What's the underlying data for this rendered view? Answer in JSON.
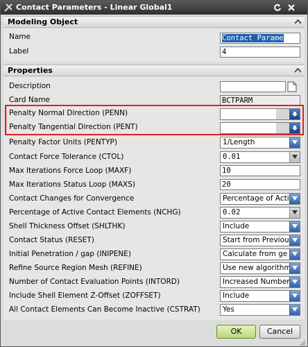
{
  "window": {
    "title": "Contact Parameters - Linear Global1"
  },
  "sections": {
    "modeling_object": "Modeling Object",
    "properties": "Properties"
  },
  "modeling_object": {
    "name_label": "Name",
    "name_value": "Contact Parame",
    "label_label": "Label",
    "label_value": "4"
  },
  "properties": {
    "description_label": "Description",
    "description_value": "",
    "card_name_label": "Card Name",
    "card_name_value": "BCTPARM",
    "penn_label": "Penalty Normal Direction (PENN)",
    "penn_value": "",
    "pent_label": "Penalty Tangential Direction (PENT)",
    "pent_value": "",
    "pentyp_label": "Penalty Factor Units (PENTYP)",
    "pentyp_value": "1/Length",
    "ctol_label": "Contact Force Tolerance (CTOL)",
    "ctol_value": "0.01",
    "maxf_label": "Max Iterations Force Loop (MAXF)",
    "maxf_value": "10",
    "maxs_label": "Max Iterations Status Loop (MAXS)",
    "maxs_value": "20",
    "convergence_label": "Contact Changes for Convergence",
    "convergence_value": "Percentage of Acti",
    "nchg_label": "Percentage of Active Contact Elements (NCHG)",
    "nchg_value": "0.02",
    "shlthk_label": "Shell Thickness Offset (SHLTHK)",
    "shlthk_value": "Include",
    "reset_label": "Contact Status (RESET)",
    "reset_value": "Start from Previou",
    "inipene_label": "Initial Penetration / gap (INIPENE)",
    "inipene_value": "Calculate from ge",
    "refine_label": "Refine Source Region Mesh (REFINE)",
    "refine_value": "Use new algorithm",
    "intord_label": "Number of Contact Evaluation Points (INTORD)",
    "intord_value": "Increased Number",
    "zoffset_label": "Include Shell Element Z-Offset (ZOFFSET)",
    "zoffset_value": "Include",
    "cstrat_label": "All Contact Elements Can Become Inactive (CSTRAT)",
    "cstrat_value": "Yes"
  },
  "buttons": {
    "ok": "OK",
    "cancel": "Cancel"
  },
  "colors": {
    "highlight_box": "#e02020",
    "selection": "#1b5fb5",
    "ok_button": "#b9d877"
  }
}
